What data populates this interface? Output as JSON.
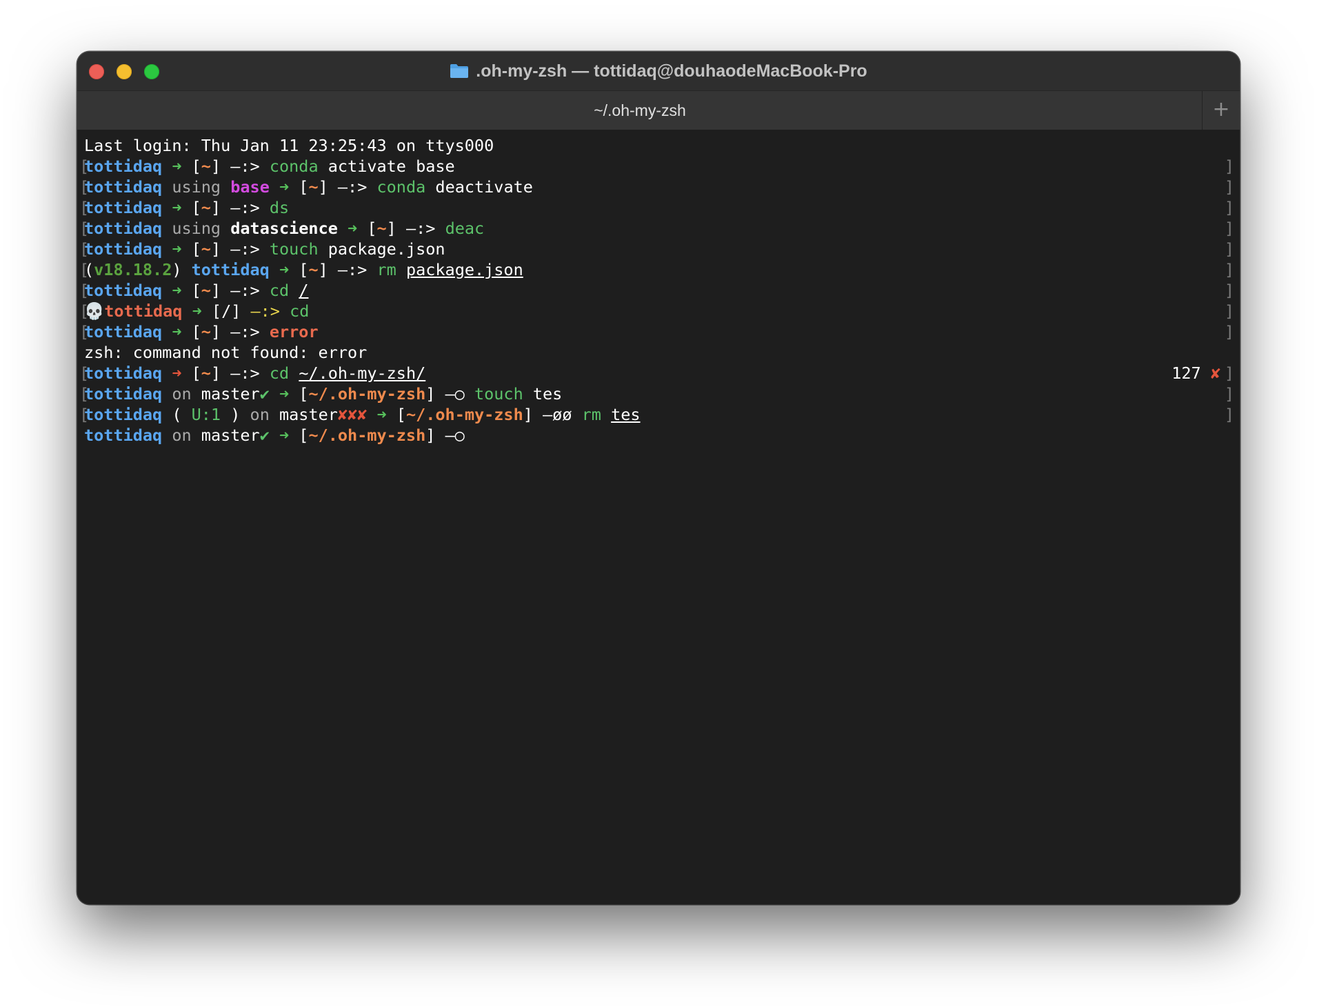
{
  "window": {
    "title": ".oh-my-zsh — tottidaq@douhaodeMacBook-Pro",
    "title_icon": "folder-icon",
    "tab_label": "~/.oh-my-zsh",
    "new_tab_label": "+"
  },
  "colors": {
    "user": "#5aa6f0",
    "arrow": "#57c05c",
    "path": "#ef8a4d",
    "command": "#5cc26a",
    "error": "#e86a4e",
    "conda_env": "#d34be0"
  },
  "terminal": {
    "login": "Last login: Thu Jan 11 23:25:43 on ttys000",
    "user": "tottidaq",
    "arrow": "➜",
    "home": "~",
    "prompt_sep": "—:>",
    "l2_cmd": "conda",
    "l2_args": "activate base",
    "l3_using": "using",
    "l3_env": "base",
    "l3_cmd": "conda",
    "l3_args": "deactivate",
    "l4_cmd": "ds",
    "l5_env": "datascience",
    "l5_cmd": "deac",
    "l6_cmd": "touch",
    "l6_args": "package.json",
    "l7_node": "v18.18.2",
    "l7_cmd": "rm",
    "l7_args": "package.json",
    "l8_cmd": "cd",
    "l8_args": "/",
    "l9_skull": "💀",
    "l9_path": "/",
    "l9_cmd": "cd",
    "l10_cmd": "error",
    "l11_output": "zsh: command not found: error",
    "l12_cmd": "cd",
    "l12_args": "~/.oh-my-zsh/",
    "l12_status": "127",
    "l12_status_icon": "✘",
    "git_on": "on",
    "git_branch": "master",
    "git_clean": "✔",
    "git_dirty": "✘✘✘",
    "omz_path": "~/.oh-my-zsh",
    "git_sep_clean": "—○",
    "git_sep_dirty": "—øø",
    "l13_cmd": "touch",
    "l13_args": "tes",
    "l14_untracked": "U:1",
    "l14_cmd": "rm",
    "l14_args": "tes"
  }
}
